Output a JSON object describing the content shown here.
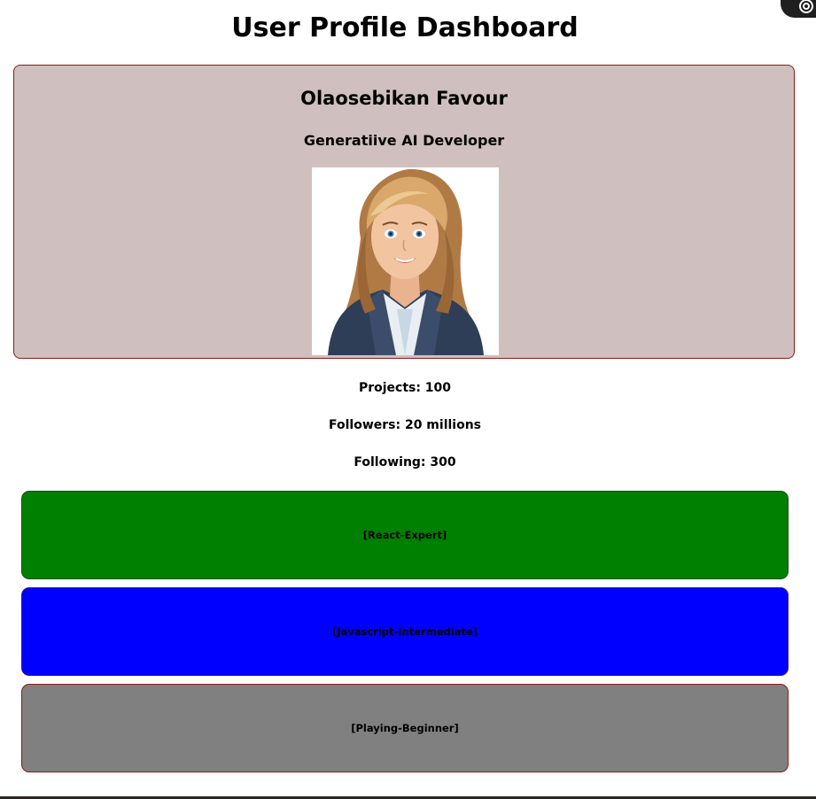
{
  "header": {
    "title": "User Profile Dashboard"
  },
  "profile": {
    "name": "Olaosebikan Favour",
    "role": "Generatiive AI Developer",
    "avatar_icon": "woman-avatar-icon"
  },
  "stats": {
    "projects": "Projects: 100",
    "followers": "Followers: 20 millions",
    "following": "Following: 300"
  },
  "skills": [
    {
      "label": "[React-Expert]",
      "color": "#008000"
    },
    {
      "label": "[Javascript-Intermediate]",
      "color": "#0000ff"
    },
    {
      "label": "[Playing-Beginner]",
      "color": "#808080"
    }
  ],
  "colors": {
    "card_background": "#d0bfbf",
    "card_border": "#8b1a1a"
  }
}
